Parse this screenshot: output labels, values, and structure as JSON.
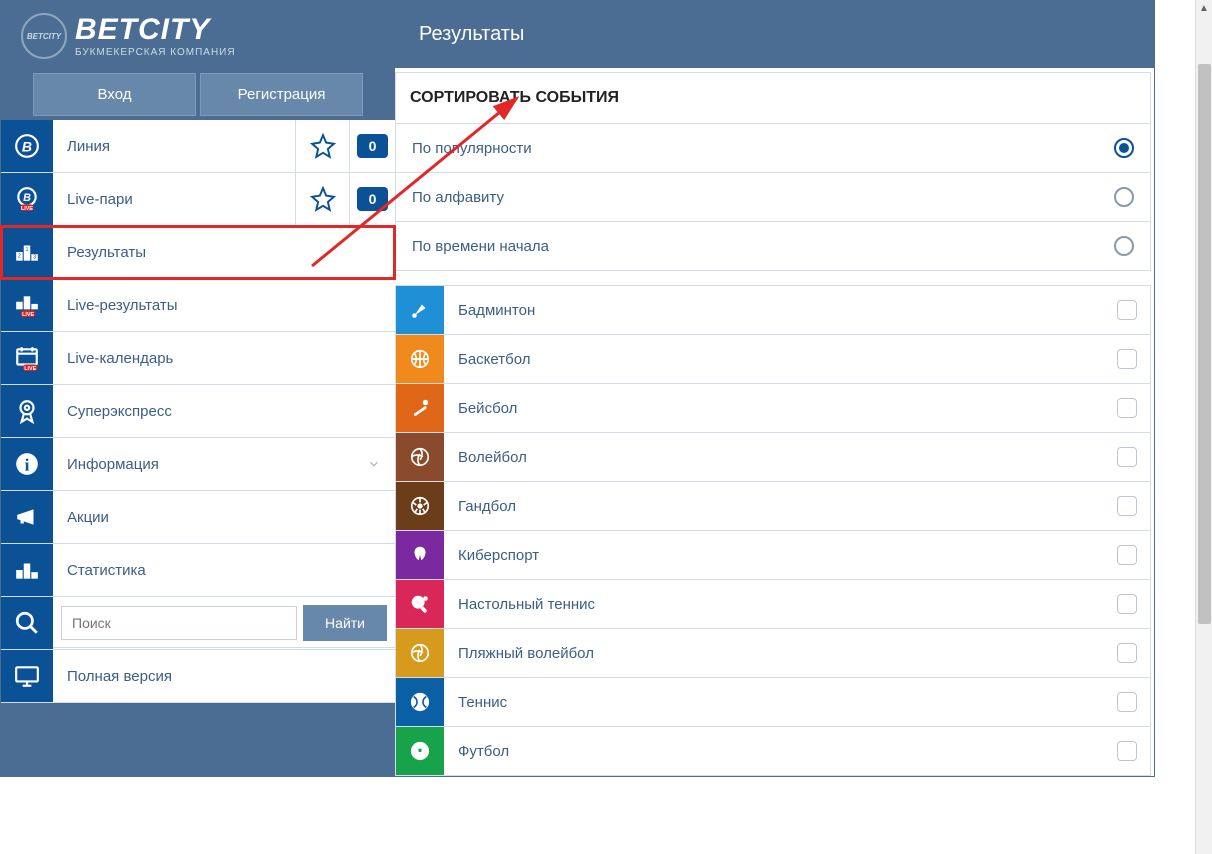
{
  "brand": {
    "name": "BETCITY",
    "tagline": "БУКМЕКЕРСКАЯ КОМПАНИЯ",
    "badge": "BETCITY"
  },
  "auth": {
    "login": "Вход",
    "register": "Регистрация"
  },
  "sidebar": {
    "items": [
      {
        "label": "Линия",
        "icon": "brand-b",
        "badge": "0",
        "star": true
      },
      {
        "label": "Live-пари",
        "icon": "brand-b-live",
        "badge": "0",
        "star": true
      },
      {
        "label": "Результаты",
        "icon": "podium"
      },
      {
        "label": "Live-результаты",
        "icon": "podium-live"
      },
      {
        "label": "Live-календарь",
        "icon": "calendar-live"
      },
      {
        "label": "Суперэкспресс",
        "icon": "rosette"
      },
      {
        "label": "Информация",
        "icon": "info",
        "chevron": true
      },
      {
        "label": "Акции",
        "icon": "megaphone"
      },
      {
        "label": "Статистика",
        "icon": "podium2"
      },
      {
        "label": "Поиск",
        "icon": "search",
        "search": true,
        "button": "Найти",
        "placeholder": "Поиск"
      },
      {
        "label": "Полная версия",
        "icon": "monitor"
      }
    ]
  },
  "page": {
    "title": "Результаты",
    "sort": {
      "heading": "СОРТИРОВАТЬ СОБЫТИЯ",
      "options": [
        {
          "label": "По популярности",
          "selected": true
        },
        {
          "label": "По алфавиту",
          "selected": false
        },
        {
          "label": "По времени начала",
          "selected": false
        }
      ]
    },
    "sports": [
      {
        "label": "Бадминтон",
        "color": "#1f8fd6"
      },
      {
        "label": "Баскетбол",
        "color": "#f08a1d"
      },
      {
        "label": "Бейсбол",
        "color": "#e06618"
      },
      {
        "label": "Волейбол",
        "color": "#8a4b2d"
      },
      {
        "label": "Гандбол",
        "color": "#6b3d18"
      },
      {
        "label": "Киберспорт",
        "color": "#7a2a9e"
      },
      {
        "label": "Настольный теннис",
        "color": "#d9275a"
      },
      {
        "label": "Пляжный волейбол",
        "color": "#d69a1d"
      },
      {
        "label": "Теннис",
        "color": "#0b5fa5"
      },
      {
        "label": "Футбол",
        "color": "#17a34a"
      }
    ]
  }
}
